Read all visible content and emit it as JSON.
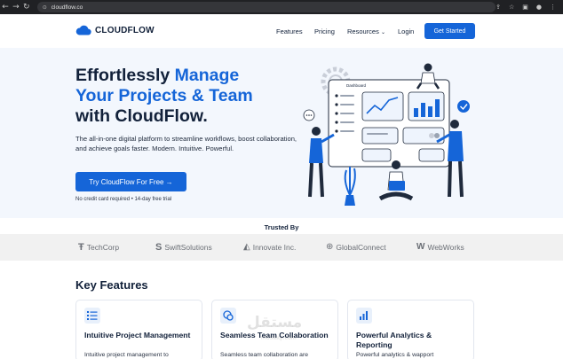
{
  "browser": {
    "url": "cloudflow.co"
  },
  "header": {
    "logo": "CLOUDFLOW",
    "nav": [
      "Features",
      "Pricing",
      "Resources",
      "Login"
    ],
    "cta": "Get Started"
  },
  "hero": {
    "title_line1_a": "Effortlessly ",
    "title_line1_b": "Manage",
    "title_line2": "Your Projects & Team",
    "title_line3": "with CloudFlow.",
    "subtitle": "The all-in-one digital platform to streamline workflows, boost collaboration, and achieve goals faster. Modern. Intuitive. Powerful.",
    "button": "Try CloudFlow For Free →",
    "note": "No credit card required • 14-day free trial",
    "dashboard_label": "Dashboard"
  },
  "trusted": {
    "title": "Trusted By",
    "brands": [
      "TechCorp",
      "SwiftSolutions",
      "Innovate Inc.",
      "GlobalConnect",
      "WebWorks"
    ]
  },
  "features": {
    "title": "Key Features",
    "cards": [
      {
        "title": "Intuitive Project Management",
        "desc": "Intuitive project management to"
      },
      {
        "title": "Seamless Team Collaboration",
        "desc": "Seamless team collaboration are"
      },
      {
        "title": "Powerful Analytics & Reporting",
        "desc": "Powerful analytics & wapport"
      }
    ]
  },
  "colors": {
    "primary": "#1565d8",
    "dark": "#12213a",
    "hero_bg": "#f3f7fd"
  }
}
